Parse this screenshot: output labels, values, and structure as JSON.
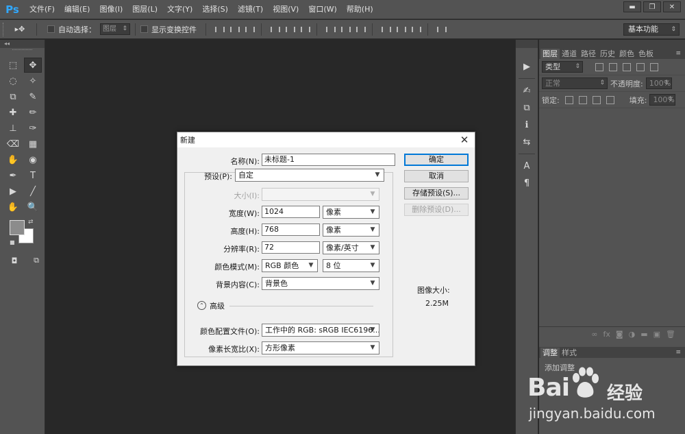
{
  "app": {
    "logo": "Ps"
  },
  "menu": [
    "文件(F)",
    "编辑(E)",
    "图像(I)",
    "图层(L)",
    "文字(Y)",
    "选择(S)",
    "滤镜(T)",
    "视图(V)",
    "窗口(W)",
    "帮助(H)"
  ],
  "window_controls": {
    "minimize": "▬",
    "restore": "❐",
    "close": "✕"
  },
  "options_bar": {
    "tool_glyph": "▸✥",
    "auto_select_label": "自动选择：",
    "auto_select_value": "图层",
    "show_transform_label": "显示变换控件",
    "workspace": "基本功能"
  },
  "toolbar": {
    "collapse": "◂◂",
    "tools": [
      "⬚",
      "✥",
      "◌",
      "✧",
      "⧉",
      "✎",
      "✚",
      "✏",
      "⊥",
      "✑",
      "⌫",
      "▦",
      "✋",
      "◉",
      "✒",
      "T",
      "▶",
      "╱",
      "✋",
      "🔍"
    ]
  },
  "right_panel": {
    "tabs": [
      "图层",
      "通道",
      "路径",
      "历史",
      "颜色",
      "色板"
    ],
    "filter_type": "类型",
    "blend_mode": "正常",
    "opacity_label": "不透明度:",
    "opacity_value": "100%",
    "lock_label": "锁定:",
    "fill_label": "填充:",
    "fill_value": "100%",
    "adj_tabs": [
      "调整",
      "样式"
    ],
    "adj_text": "添加调整"
  },
  "dock_narrow": [
    "▶",
    "✍",
    "⧉",
    "ℹ",
    "⇆",
    "A",
    "¶"
  ],
  "dialog": {
    "title": "新建",
    "close": "✕",
    "name_label": "名称(N):",
    "name_value": "未标题-1",
    "preset_label": "预设(P):",
    "preset_value": "自定",
    "size_label": "大小(I):",
    "width_label": "宽度(W):",
    "width_value": "1024",
    "width_unit": "像素",
    "height_label": "高度(H):",
    "height_value": "768",
    "height_unit": "像素",
    "resolution_label": "分辨率(R):",
    "resolution_value": "72",
    "resolution_unit": "像素/英寸",
    "color_mode_label": "颜色模式(M):",
    "color_mode_value": "RGB 颜色",
    "bit_depth_value": "8 位",
    "background_label": "背景内容(C):",
    "background_value": "背景色",
    "advanced_label": "高级",
    "profile_label": "颜色配置文件(O):",
    "profile_value": "工作中的 RGB: sRGB IEC6196...",
    "aspect_label": "像素长宽比(X):",
    "aspect_value": "方形像素",
    "ok": "确定",
    "cancel": "取消",
    "save_preset": "存储预设(S)...",
    "delete_preset": "删除预设(D)...",
    "image_size_label": "图像大小:",
    "image_size_value": "2.25M"
  },
  "watermark": {
    "brand": "Bai",
    "brand_cn": "经验",
    "url": "jingyan.baidu.com"
  }
}
